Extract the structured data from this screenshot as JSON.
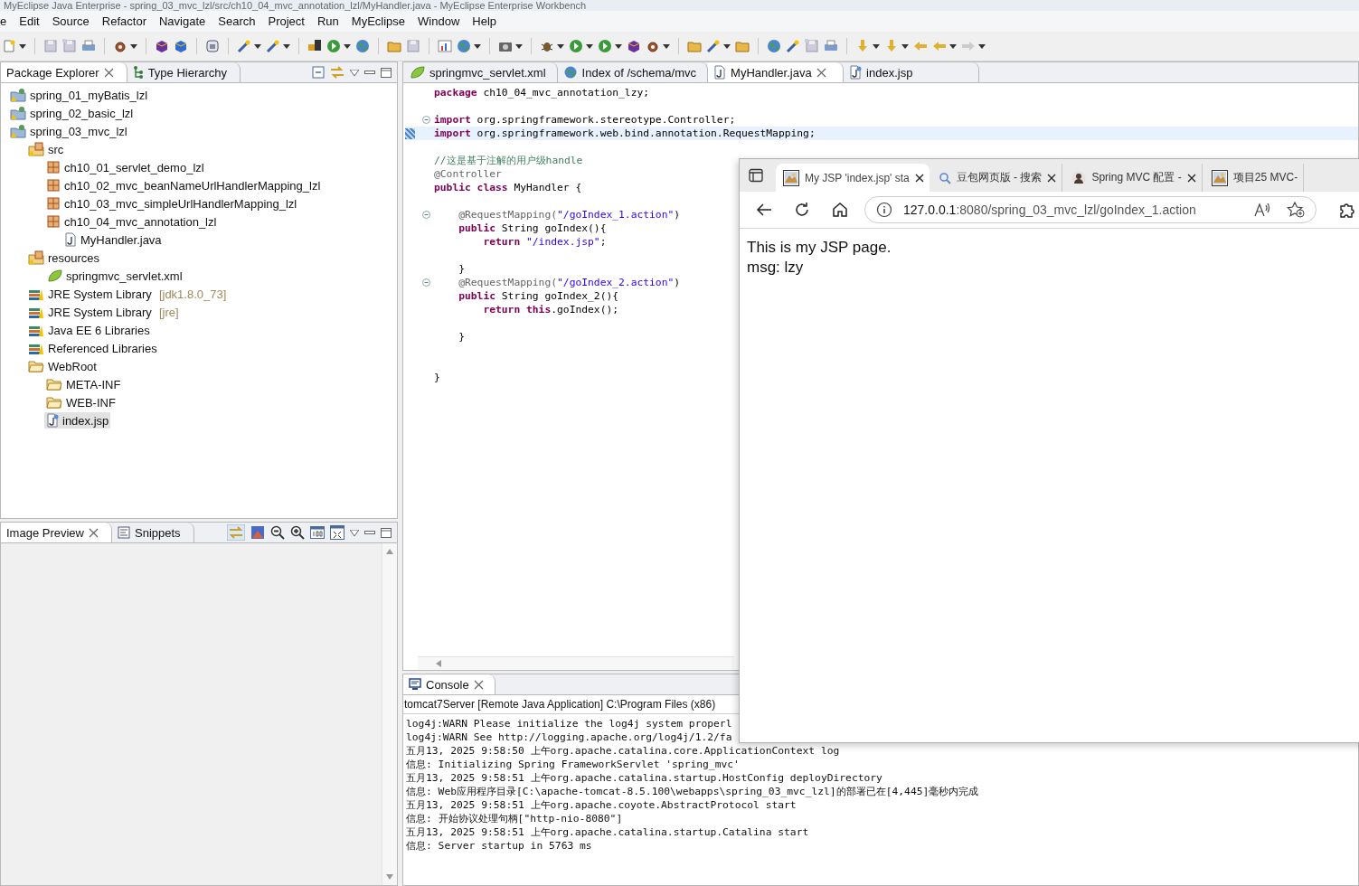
{
  "window": {
    "title": "MyEclipse Java Enterprise - spring_03_mvc_lzl/src/ch10_04_mvc_annotation_lzl/MyHandler.java - MyEclipse Enterprise Workbench"
  },
  "menu": [
    "e",
    "Edit",
    "Source",
    "Refactor",
    "Navigate",
    "Search",
    "Project",
    "Run",
    "MyEclipse",
    "Window",
    "Help"
  ],
  "package_explorer": {
    "tabs": [
      {
        "label": "Package Explorer",
        "selected": true
      },
      {
        "label": "Type Hierarchy",
        "selected": false
      }
    ],
    "tree": [
      {
        "label": "spring_01_myBatis_lzl",
        "kind": "project",
        "selected": false
      },
      {
        "label": "spring_02_basic_lzl",
        "kind": "project",
        "selected": false
      },
      {
        "label": "spring_03_mvc_lzl",
        "kind": "project",
        "selected": false,
        "children": [
          {
            "label": "src",
            "kind": "source-folder",
            "selected": false,
            "children": [
              {
                "label": "ch10_01_servlet_demo_lzl",
                "kind": "package",
                "selected": false
              },
              {
                "label": "ch10_02_mvc_beanNameUrlHandlerMapping_lzl",
                "kind": "package",
                "selected": false
              },
              {
                "label": "ch10_03_mvc_simpleUrlHandlerMapping_lzl",
                "kind": "package",
                "selected": false
              },
              {
                "label": "ch10_04_mvc_annotation_lzl",
                "kind": "package",
                "selected": false,
                "children": [
                  {
                    "label": "MyHandler.java",
                    "kind": "java-file",
                    "selected": false
                  }
                ]
              }
            ]
          },
          {
            "label": "resources",
            "kind": "source-folder",
            "selected": false,
            "children": [
              {
                "label": "springmvc_servlet.xml",
                "kind": "xml-file",
                "selected": false
              }
            ]
          },
          {
            "label": "JRE System Library",
            "detail": "[jdk1.8.0_73]",
            "kind": "library",
            "selected": false
          },
          {
            "label": "JRE System Library",
            "detail": "[jre]",
            "kind": "library",
            "selected": false
          },
          {
            "label": "Java EE 6 Libraries",
            "kind": "library",
            "selected": false
          },
          {
            "label": "Referenced Libraries",
            "kind": "library",
            "selected": false
          },
          {
            "label": "WebRoot",
            "kind": "folder",
            "selected": false,
            "children": [
              {
                "label": "META-INF",
                "kind": "folder",
                "selected": false
              },
              {
                "label": "WEB-INF",
                "kind": "folder",
                "selected": false
              },
              {
                "label": "index.jsp",
                "kind": "jsp-file",
                "selected": true
              }
            ]
          }
        ]
      }
    ]
  },
  "image_preview": {
    "tabs": [
      {
        "label": "Image Preview",
        "selected": true
      },
      {
        "label": "Snippets",
        "selected": false
      }
    ]
  },
  "editor": {
    "tabs": [
      {
        "label": "springmvc_servlet.xml",
        "kind": "xml-file",
        "selected": false
      },
      {
        "label": "Index of /schema/mvc",
        "kind": "web-page",
        "selected": false
      },
      {
        "label": "MyHandler.java",
        "kind": "java-file",
        "selected": true
      },
      {
        "label": "index.jsp",
        "kind": "jsp-file",
        "selected": false
      }
    ],
    "lines": [
      {
        "fold": false,
        "current": false,
        "segments": [
          {
            "text": "package",
            "kind": "keyword"
          },
          {
            "text": " ch10_04_mvc_annotation_lzy;",
            "kind": "plain"
          }
        ]
      },
      {
        "fold": false,
        "current": false
      },
      {
        "fold": true,
        "current": false,
        "segments": [
          {
            "text": "import",
            "kind": "keyword"
          },
          {
            "text": " org.springframework.stereotype.Controller;",
            "kind": "plain"
          }
        ]
      },
      {
        "fold": false,
        "current": true,
        "segments": [
          {
            "text": "import",
            "kind": "keyword"
          },
          {
            "text": " org.springframework.web.bind.annotation.RequestMapping;",
            "kind": "plain"
          }
        ]
      },
      {
        "fold": false,
        "current": false
      },
      {
        "fold": false,
        "current": false,
        "segments": [
          {
            "text": "//这是基于注解的用户级handle",
            "kind": "comment"
          }
        ]
      },
      {
        "fold": false,
        "current": false,
        "segments": [
          {
            "text": "@Controller",
            "kind": "annotation"
          }
        ]
      },
      {
        "fold": false,
        "current": false,
        "segments": [
          {
            "text": "public class",
            "kind": "keyword"
          },
          {
            "text": " MyHandler {",
            "kind": "plain"
          }
        ]
      },
      {
        "fold": false,
        "current": false
      },
      {
        "fold": true,
        "current": false,
        "segments": [
          {
            "text": "    @RequestMapping(",
            "kind": "annotation"
          },
          {
            "text": "\"/goIndex_1.action\"",
            "kind": "string"
          },
          {
            "text": ")",
            "kind": "plain"
          }
        ]
      },
      {
        "fold": false,
        "current": false,
        "segments": [
          {
            "text": "    public",
            "kind": "keyword"
          },
          {
            "text": " String goIndex(){",
            "kind": "plain"
          }
        ]
      },
      {
        "fold": false,
        "current": false,
        "segments": [
          {
            "text": "        return",
            "kind": "keyword"
          },
          {
            "text": " \"/index.jsp\"",
            "kind": "string"
          },
          {
            "text": ";",
            "kind": "plain"
          }
        ]
      },
      {
        "fold": false,
        "current": false
      },
      {
        "fold": false,
        "current": false,
        "segments": [
          {
            "text": "    }",
            "kind": "plain"
          }
        ]
      },
      {
        "fold": true,
        "current": false,
        "segments": [
          {
            "text": "    @RequestMapping(",
            "kind": "annotation"
          },
          {
            "text": "\"/goIndex_2.action\"",
            "kind": "string"
          },
          {
            "text": ")",
            "kind": "plain"
          }
        ]
      },
      {
        "fold": false,
        "current": false,
        "segments": [
          {
            "text": "    public",
            "kind": "keyword"
          },
          {
            "text": " String goIndex_2(){",
            "kind": "plain"
          }
        ]
      },
      {
        "fold": false,
        "current": false,
        "segments": [
          {
            "text": "        return this",
            "kind": "keyword"
          },
          {
            "text": ".goIndex();",
            "kind": "plain"
          }
        ]
      },
      {
        "fold": false,
        "current": false
      },
      {
        "fold": false,
        "current": false,
        "segments": [
          {
            "text": "    }",
            "kind": "plain"
          }
        ]
      },
      {
        "fold": false,
        "current": false
      },
      {
        "fold": false,
        "current": false
      },
      {
        "fold": false,
        "current": false,
        "segments": [
          {
            "text": "}",
            "kind": "plain"
          }
        ]
      }
    ]
  },
  "console": {
    "tab": "Console",
    "launch": "tomcat7Server [Remote Java Application] C:\\Program Files (x86)",
    "lines": [
      "log4j:WARN Please initialize the log4j system properl",
      "log4j:WARN See http://logging.apache.org/log4j/1.2/fa",
      "五月13, 2025 9:58:50 上午org.apache.catalina.core.ApplicationContext log",
      "信息: Initializing Spring FrameworkServlet 'spring_mvc'",
      "五月13, 2025 9:58:51 上午org.apache.catalina.startup.HostConfig deployDirectory",
      "信息: Web应用程序目录[C:\\apache-tomcat-8.5.100\\webapps\\spring_03_mvc_lzl]的部署已在[4,445]毫秒内完成",
      "五月13, 2025 9:58:51 上午org.apache.coyote.AbstractProtocol start",
      "信息: 开始协议处理句柄[\"http-nio-8080\"]",
      "五月13, 2025 9:58:51 上午org.apache.catalina.startup.Catalina start",
      "信息: Server startup in 5763 ms"
    ]
  },
  "browser": {
    "tabs": [
      {
        "label": "My JSP 'index.jsp' sta",
        "selected": true
      },
      {
        "label": "豆包网页版 - 搜索",
        "selected": false
      },
      {
        "label": "Spring MVC 配置 - ",
        "selected": false
      },
      {
        "label": "项目25 MVC-",
        "selected": false
      }
    ],
    "address": {
      "host": "127.0.0.1",
      "path": ":8080/spring_03_mvc_lzl/goIndex_1.action"
    },
    "page": [
      "This is my JSP page.",
      "msg: lzy"
    ]
  }
}
